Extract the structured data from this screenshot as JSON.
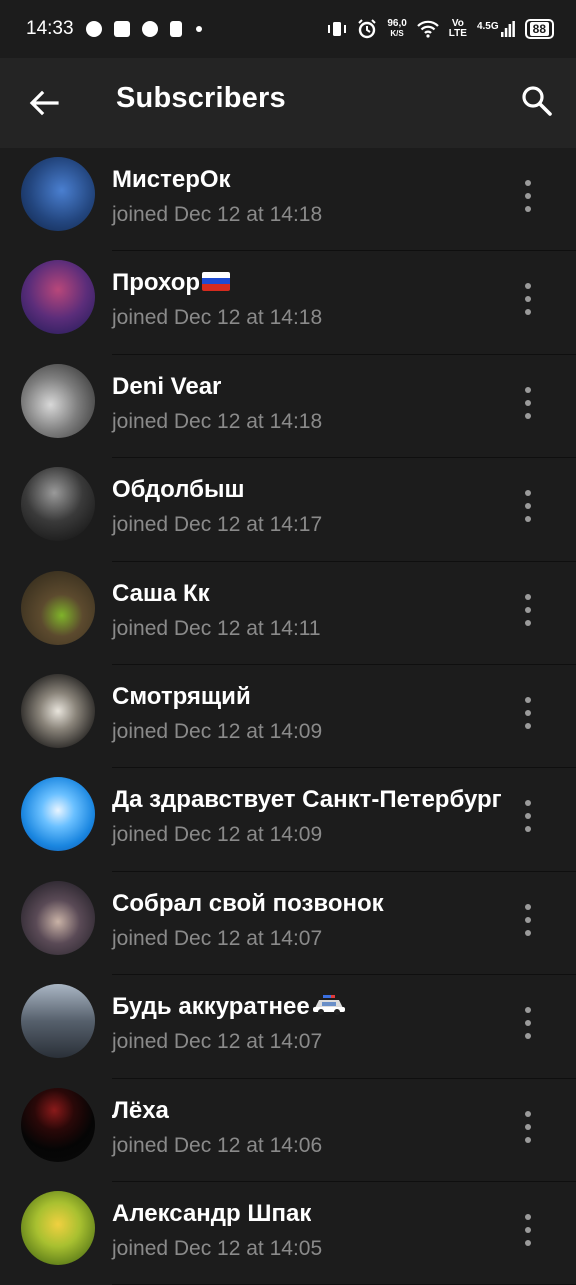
{
  "status_bar": {
    "time": "14:33",
    "speed_value": "96,0",
    "speed_unit": "K/S",
    "volte_top": "Vo",
    "volte_bottom": "LTE",
    "network": "4.5G",
    "battery": "88"
  },
  "header": {
    "title": "Subscribers",
    "back_icon": "arrow-back-icon",
    "search_icon": "search-icon"
  },
  "subscribers": [
    {
      "name": "МистерОк",
      "joined": "joined Dec 12 at 14:18",
      "avatar_color": "#2d5aa8",
      "emoji": ""
    },
    {
      "name": "Прохор",
      "joined": "joined Dec 12 at 14:18",
      "avatar_color": "#5b2d7a",
      "emoji": "russia-flag"
    },
    {
      "name": "Deni Vear",
      "joined": "joined Dec 12 at 14:18",
      "avatar_color": "#8c8c8c",
      "emoji": ""
    },
    {
      "name": "Обдолбыш",
      "joined": "joined Dec 12 at 14:17",
      "avatar_color": "#3a3a3a",
      "emoji": ""
    },
    {
      "name": "Саша Кк",
      "joined": "joined Dec 12 at 14:11",
      "avatar_color": "#5c4a2e",
      "emoji": ""
    },
    {
      "name": "Смотрящий",
      "joined": "joined Dec 12 at 14:09",
      "avatar_color": "#6e6a64",
      "emoji": ""
    },
    {
      "name": "Да здравствует Санкт-Петербург",
      "joined": "joined Dec 12 at 14:09",
      "avatar_color": "#1a86e0",
      "emoji": ""
    },
    {
      "name": "Собрал свой позвонок",
      "joined": "joined Dec 12 at 14:07",
      "avatar_color": "#2a2a34",
      "emoji": ""
    },
    {
      "name": "Будь аккуратнее",
      "joined": "joined Dec 12 at 14:07",
      "avatar_color": "#56606c",
      "emoji": "police-car"
    },
    {
      "name": "Лёха",
      "joined": "joined Dec 12 at 14:06",
      "avatar_color": "#0a0a0a",
      "emoji": ""
    },
    {
      "name": "Александр Шпак",
      "joined": "joined Dec 12 at 14:05",
      "avatar_color": "#7a9a20",
      "emoji": ""
    }
  ],
  "colors": {
    "background": "#1c1c1c",
    "app_bar": "#242424",
    "secondary_text": "#8a8a8a"
  }
}
